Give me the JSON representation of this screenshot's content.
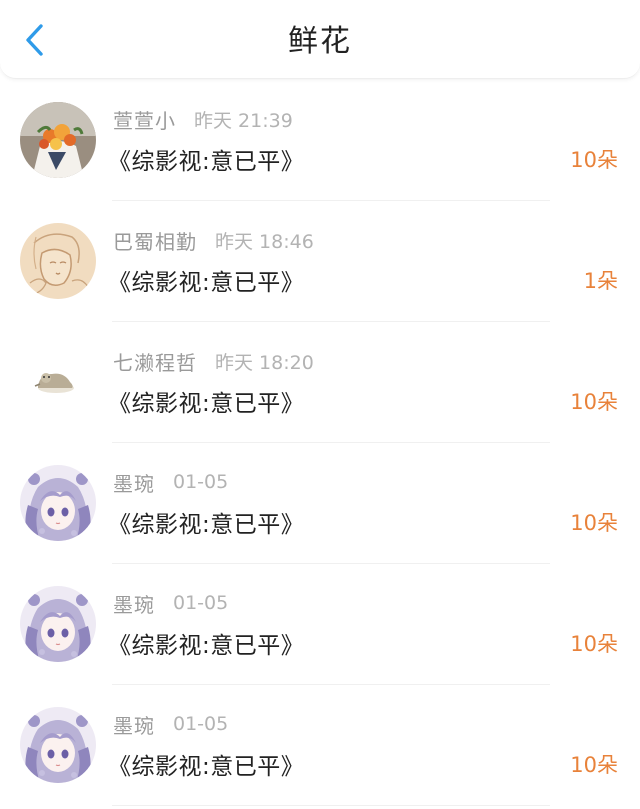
{
  "header": {
    "title": "鲜花",
    "back_icon": "chevron-left-icon",
    "accent": "#2f9be9"
  },
  "colors": {
    "amount": "#e8823a",
    "meta": "#9a9a9a"
  },
  "records": [
    {
      "user": "萱萱小",
      "time": "昨天 21:39",
      "book": "《综影视:意已平》",
      "amount": "10朵",
      "avatar": "flower-bouquet"
    },
    {
      "user": "巴蜀相勤",
      "time": "昨天 18:46",
      "book": "《综影视:意已平》",
      "amount": "1朵",
      "avatar": "sketch-portrait"
    },
    {
      "user": "七濑程哲",
      "time": "昨天 18:20",
      "book": "《综影视:意已平》",
      "amount": "10朵",
      "avatar": "small-creature"
    },
    {
      "user": "墨琬",
      "time": "01-05",
      "book": "《综影视:意已平》",
      "amount": "10朵",
      "avatar": "anime-girl"
    },
    {
      "user": "墨琬",
      "time": "01-05",
      "book": "《综影视:意已平》",
      "amount": "10朵",
      "avatar": "anime-girl"
    },
    {
      "user": "墨琬",
      "time": "01-05",
      "book": "《综影视:意已平》",
      "amount": "10朵",
      "avatar": "anime-girl"
    }
  ]
}
